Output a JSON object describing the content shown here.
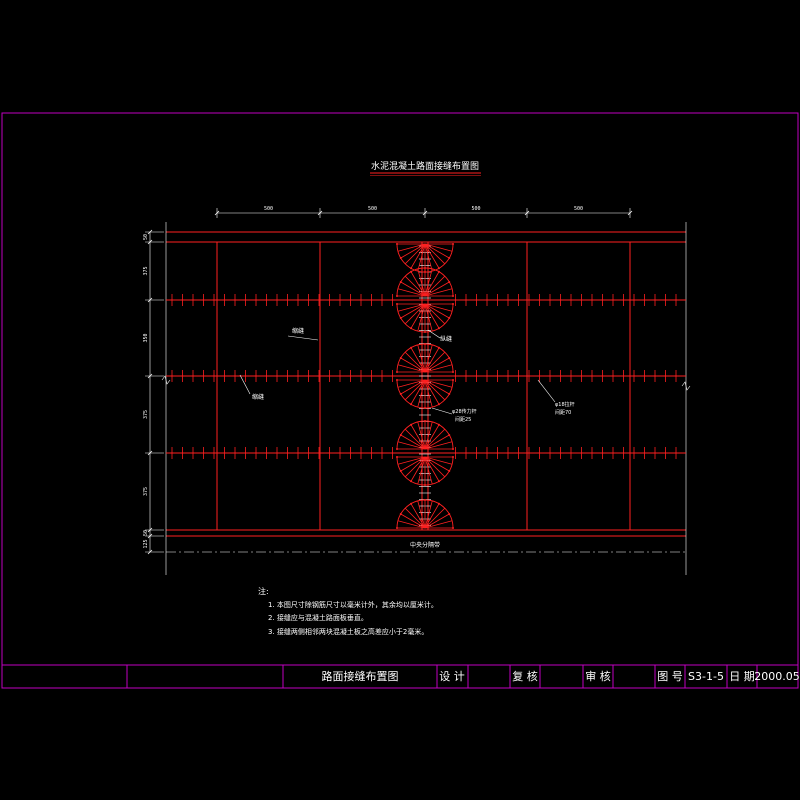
{
  "drawing": {
    "title": "水泥混凝土路面接缝布置图",
    "colors": {
      "background": "#000000",
      "frame": "#c000c0",
      "joint": "#ff2020",
      "dim": "#ffffff",
      "text": "#ffffff"
    },
    "top_dims": [
      "500",
      "500",
      "500",
      "500"
    ],
    "left_dims": [
      "50",
      "375",
      "350",
      "375",
      "375",
      "50",
      "125"
    ],
    "labels": {
      "left_top": "缩缝",
      "left_mid": "缩缝",
      "center_top": "纵缝",
      "center_bar_1": "φ28传力杆",
      "center_bar_2": "间距25",
      "right_bar_1": "φ18拉杆",
      "right_bar_2": "间距70",
      "median": "中央分隔带"
    },
    "notes_title": "注:",
    "notes": [
      "1. 本图尺寸除钢筋尺寸以毫米计外，其余均以厘米计。",
      "2. 接缝应与混凝土路面板垂直。",
      "3. 接缝两侧相邻两块混凝土板之高差应小于2毫米。"
    ]
  },
  "title_block": {
    "drawing_name": "路面接缝布置图",
    "design": "设 计",
    "review": "复 核",
    "approve": "审 核",
    "sheet_no_label": "图 号",
    "sheet_no": "S3-1-5",
    "date_label": "日 期",
    "date": "2000.05"
  }
}
